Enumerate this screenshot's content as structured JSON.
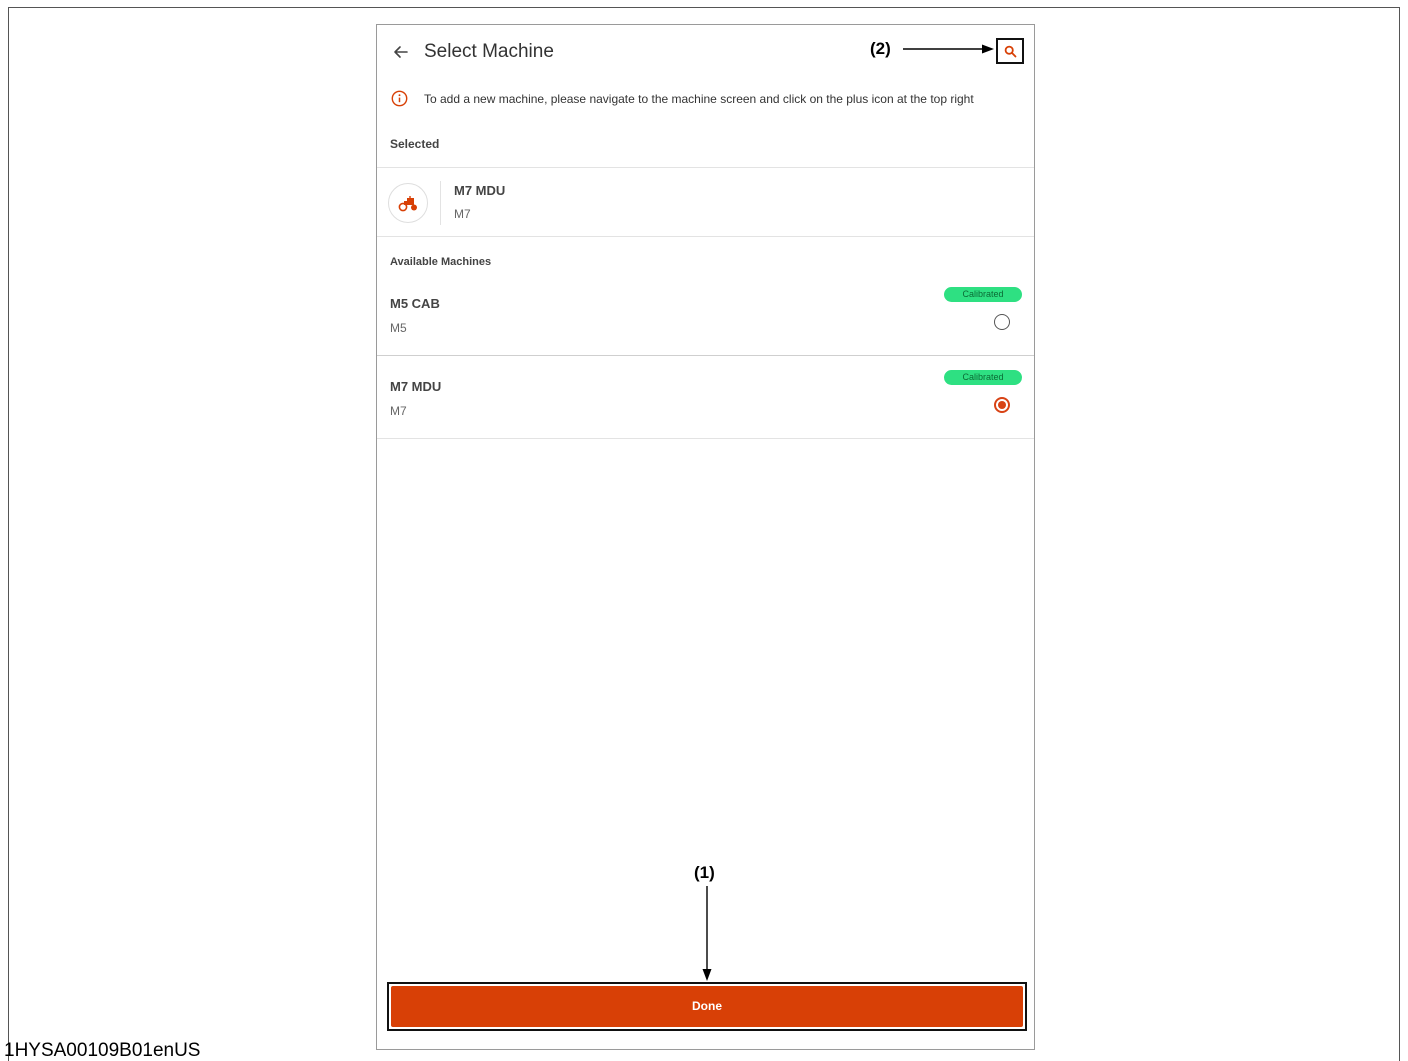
{
  "header": {
    "title": "Select Machine",
    "back_icon": "arrow-left-icon",
    "search_icon": "search-icon"
  },
  "info": {
    "icon": "info-icon",
    "text": "To add a new machine, please navigate to the machine screen and click on the plus icon at the top right"
  },
  "selected": {
    "label": "Selected",
    "machine": {
      "name": "M7 MDU",
      "model": "M7",
      "icon": "tractor-icon"
    }
  },
  "available": {
    "label": "Available Machines",
    "machines": [
      {
        "name": "M5 CAB",
        "model": "M5",
        "badge": "Calibrated",
        "selected": false
      },
      {
        "name": "M7 MDU",
        "model": "M7",
        "badge": "Calibrated",
        "selected": true
      }
    ]
  },
  "done_label": "Done",
  "callouts": {
    "one": "(1)",
    "two": "(2)"
  },
  "doc_code": "1HYSA00109B01enUS",
  "colors": {
    "accent": "#d84006",
    "badge": "#2ee082"
  }
}
